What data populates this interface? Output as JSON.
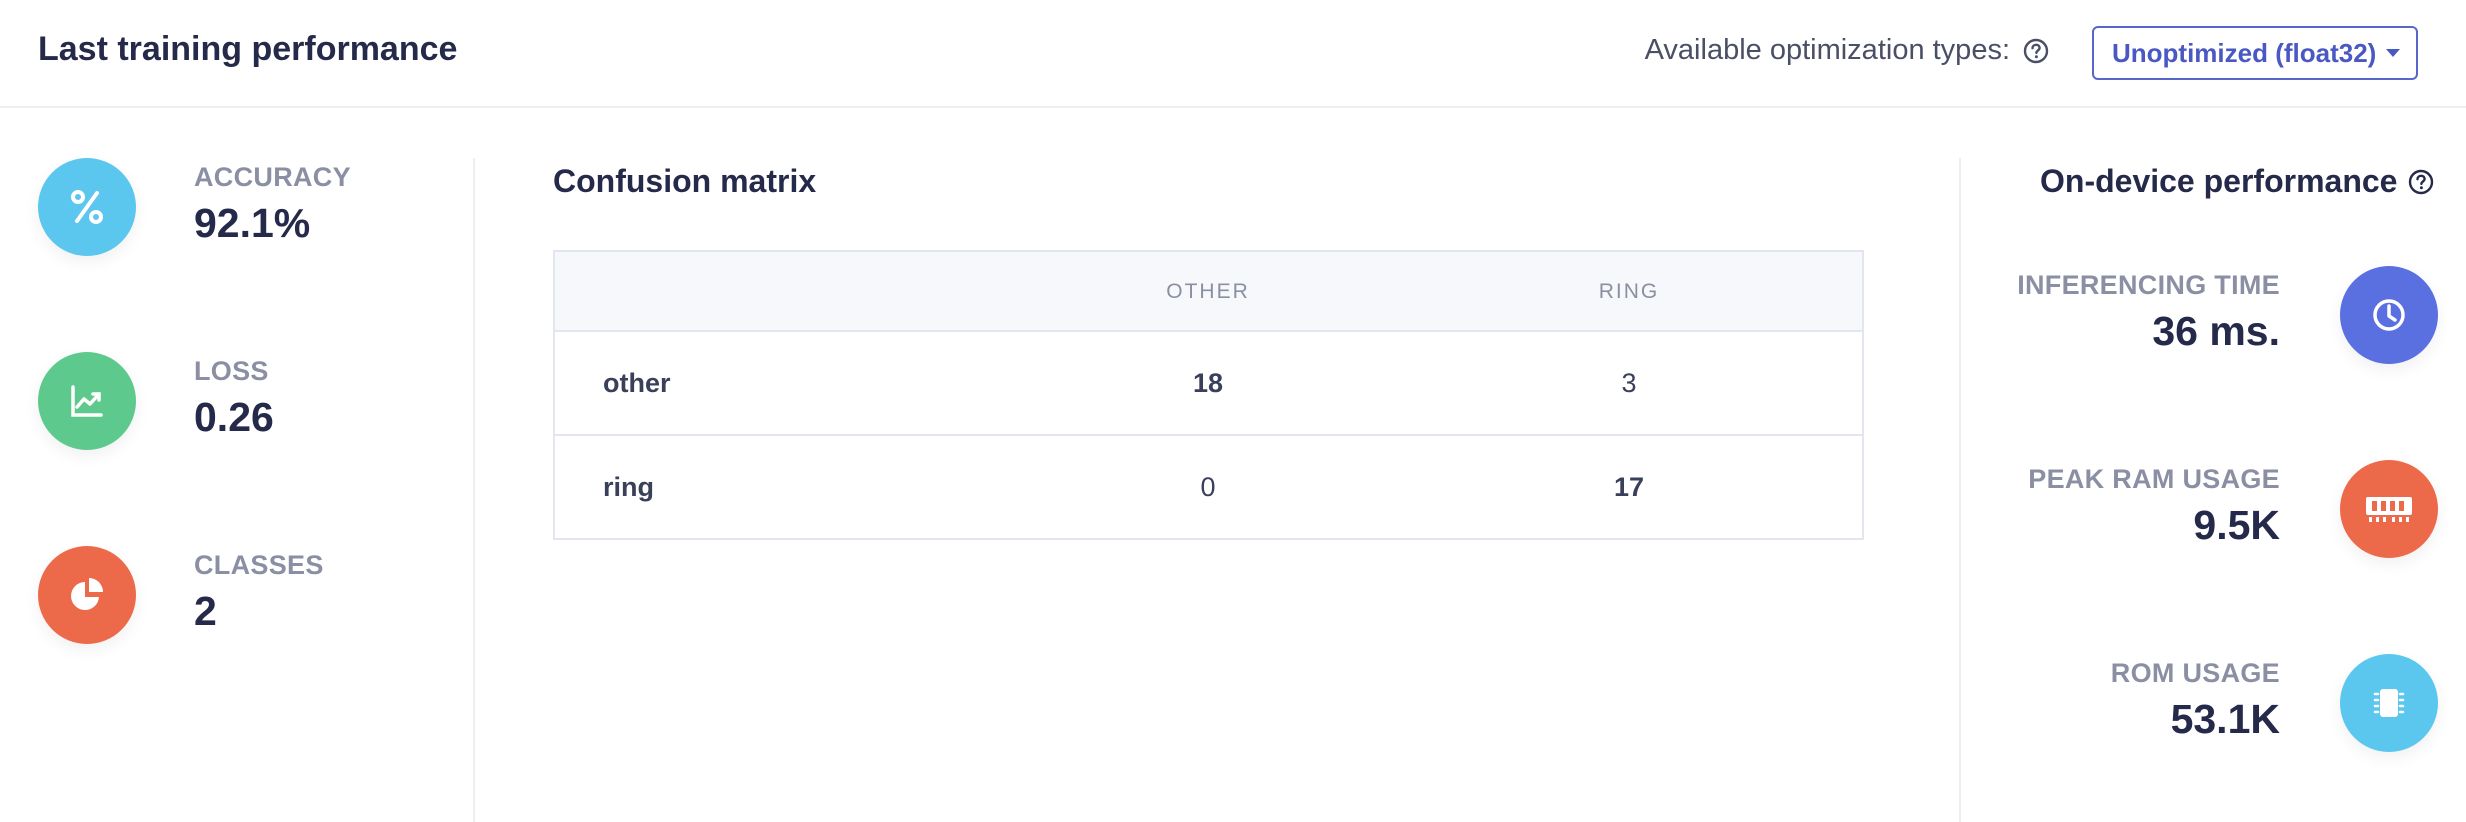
{
  "header": {
    "title": "Last training performance",
    "optimization_label": "Available optimization types:",
    "optimization_selected": "Unoptimized (float32)"
  },
  "metrics": [
    {
      "label": "ACCURACY",
      "value": "92.1%",
      "icon": "percent-icon",
      "color": "#5bc7ee"
    },
    {
      "label": "LOSS",
      "value": "0.26",
      "icon": "chart-trend-icon",
      "color": "#5ec98d"
    },
    {
      "label": "CLASSES",
      "value": "2",
      "icon": "pie-chart-icon",
      "color": "#ec6a4a"
    }
  ],
  "confusion_matrix": {
    "title": "Confusion matrix",
    "columns": [
      "OTHER",
      "RING"
    ],
    "rows": [
      {
        "label": "other",
        "values": [
          "18",
          "3"
        ]
      },
      {
        "label": "ring",
        "values": [
          "0",
          "17"
        ]
      }
    ]
  },
  "on_device": {
    "title": "On-device performance",
    "items": [
      {
        "label": "INFERENCING TIME",
        "value": "36 ms.",
        "icon": "clock-icon",
        "color": "#5a6fe0"
      },
      {
        "label": "PEAK RAM USAGE",
        "value": "9.5K",
        "icon": "ram-icon",
        "color": "#ec6a4a"
      },
      {
        "label": "ROM USAGE",
        "value": "53.1K",
        "icon": "chip-icon",
        "color": "#5bc7ee"
      }
    ]
  }
}
